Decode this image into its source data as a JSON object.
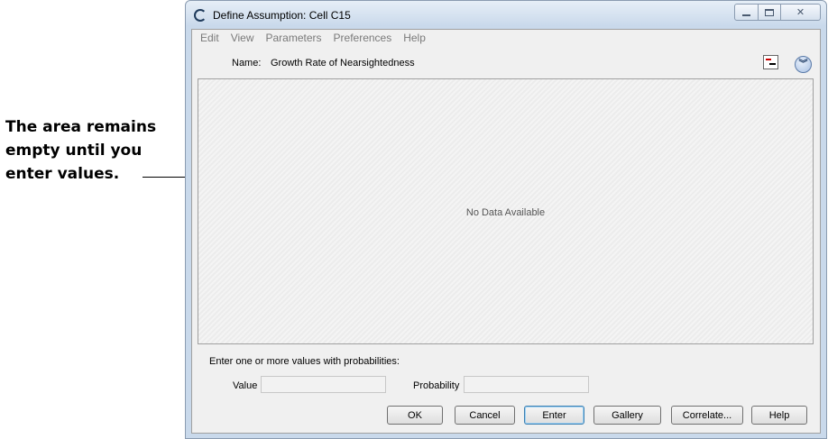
{
  "annotation": {
    "lines": [
      "The area remains",
      "empty until you",
      "enter values."
    ]
  },
  "window": {
    "title": "Define Assumption: Cell C15"
  },
  "menubar": {
    "items": [
      "Edit",
      "View",
      "Parameters",
      "Preferences",
      "Help"
    ]
  },
  "name_row": {
    "label": "Name:",
    "value": "Growth Rate of Nearsightedness"
  },
  "chart": {
    "empty_message": "No Data Available"
  },
  "entry": {
    "hint": "Enter one or more values with probabilities:",
    "value_label": "Value",
    "value": "",
    "probability_label": "Probability",
    "probability": ""
  },
  "buttons": {
    "ok": "OK",
    "cancel": "Cancel",
    "enter": "Enter",
    "gallery": "Gallery",
    "correlate": "Correlate...",
    "help": "Help"
  },
  "icons": {
    "app": "crystal-ball-icon",
    "name_cell": "cell-select-icon",
    "expand": "double-chevron-down-icon"
  },
  "colors": {
    "titlebar": "#c9d9eb",
    "client_bg": "#f0f0f0",
    "default_button_border": "#3c7fb1"
  }
}
